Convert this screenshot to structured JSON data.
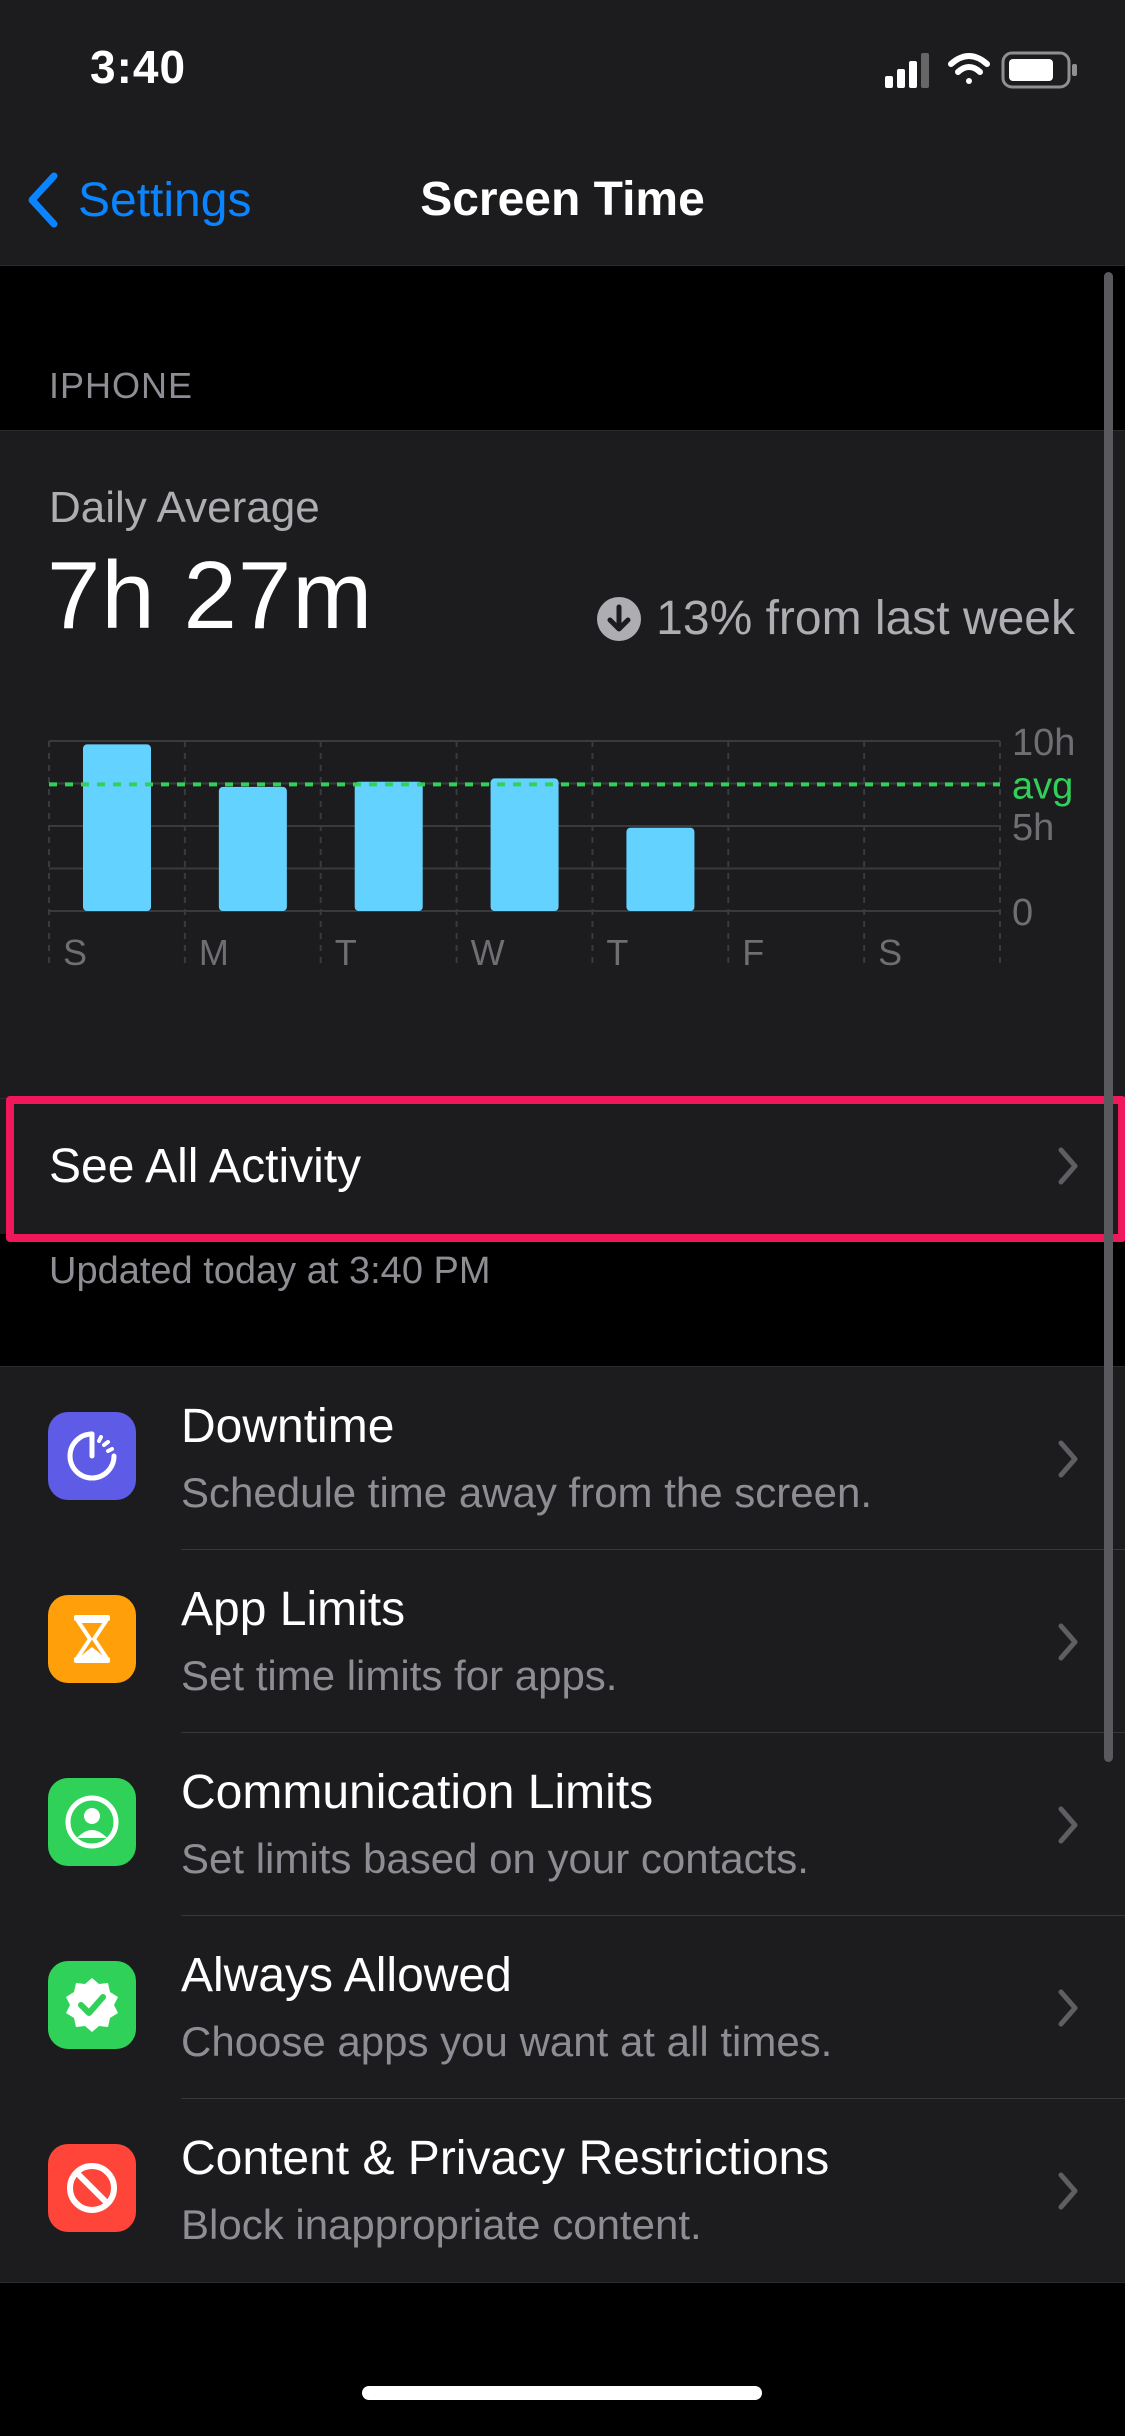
{
  "status_bar": {
    "time": "3:40"
  },
  "nav": {
    "back_label": "Settings",
    "title": "Screen Time"
  },
  "section": {
    "header": "IPHONE"
  },
  "summary": {
    "daily_label": "Daily Average",
    "daily_value": "7h 27m",
    "trend_text": "13% from last week",
    "trend_direction": "down"
  },
  "chart_data": {
    "type": "bar",
    "categories": [
      "S",
      "M",
      "T",
      "W",
      "T",
      "F",
      "S"
    ],
    "values": [
      9.8,
      7.3,
      7.6,
      7.8,
      4.9,
      null,
      null
    ],
    "y_ticks": [
      {
        "value": 10,
        "label": "10h"
      },
      {
        "value": 5,
        "label": "5h"
      },
      {
        "value": 0,
        "label": "0"
      }
    ],
    "average": 7.45,
    "average_label": "avg",
    "ylim": [
      0,
      10
    ],
    "bar_color": "#64d2ff",
    "average_color": "#30d158"
  },
  "activity": {
    "label": "See All Activity",
    "updated": "Updated today at 3:40 PM"
  },
  "settings_items": [
    {
      "title": "Downtime",
      "subtitle": "Schedule time away from the screen.",
      "icon": "downtime-icon",
      "color": "#5e5ce6"
    },
    {
      "title": "App Limits",
      "subtitle": "Set time limits for apps.",
      "icon": "hourglass-icon",
      "color": "#ff9f0a"
    },
    {
      "title": "Communication Limits",
      "subtitle": "Set limits based on your contacts.",
      "icon": "contact-icon",
      "color": "#30d158"
    },
    {
      "title": "Always Allowed",
      "subtitle": "Choose apps you want at all times.",
      "icon": "checkmark-badge-icon",
      "color": "#30d158"
    },
    {
      "title": "Content & Privacy Restrictions",
      "subtitle": "Block inappropriate content.",
      "icon": "restriction-icon",
      "color": "#ff453a"
    }
  ],
  "colors": {
    "accent": "#0a84ff",
    "highlight": "#f0185a",
    "background": "#000000",
    "card": "#1c1c1e"
  }
}
